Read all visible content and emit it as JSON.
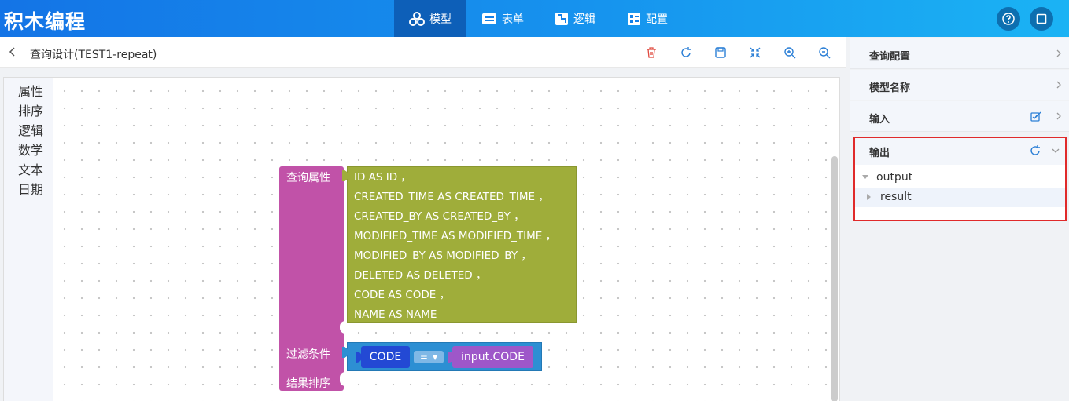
{
  "app": {
    "title": "积木编程"
  },
  "nav": {
    "tabs": [
      {
        "label": "模型",
        "icon": "cubes-icon",
        "active": true
      },
      {
        "label": "表单",
        "icon": "form-icon",
        "active": false
      },
      {
        "label": "逻辑",
        "icon": "logic-icon",
        "active": false
      },
      {
        "label": "配置",
        "icon": "config-icon",
        "active": false
      }
    ],
    "right_icons": [
      "help-icon",
      "fullscreen-icon"
    ]
  },
  "header": {
    "title": "查询设计(TEST1-repeat)",
    "toolbar": [
      "delete-icon",
      "refresh-icon",
      "save-icon",
      "collapse-icon",
      "zoom-in-icon",
      "zoom-out-icon"
    ]
  },
  "toolbox": {
    "categories": [
      "属性",
      "排序",
      "逻辑",
      "数学",
      "文本",
      "日期"
    ]
  },
  "blocks": {
    "query_label": "查询属性",
    "fields": [
      "ID AS ID ，",
      "CREATED_TIME AS CREATED_TIME ，",
      "CREATED_BY AS CREATED_BY ，",
      "MODIFIED_TIME AS MODIFIED_TIME ，",
      "MODIFIED_BY AS MODIFIED_BY ，",
      "DELETED AS DELETED ，",
      "CODE AS CODE ，",
      "NAME AS NAME"
    ],
    "filter_label": "过滤条件",
    "filter_field": "CODE",
    "filter_op": "=",
    "filter_value": "input.CODE",
    "sort_label": "结果排序"
  },
  "right_panel": {
    "sections": [
      "查询配置",
      "模型名称",
      "输入"
    ],
    "output_title": "输出",
    "tree": [
      {
        "label": "output",
        "expanded": true
      },
      {
        "label": "result",
        "expanded": false
      }
    ]
  },
  "colors": {
    "accent": "#1474e6",
    "query_block": "#c152a8",
    "fields_block": "#9fad3a",
    "filter_block": "#2d8fd3",
    "field_ref_block": "#2349d4",
    "value_block": "#9e57c9",
    "highlight_border": "#e02a2a"
  }
}
